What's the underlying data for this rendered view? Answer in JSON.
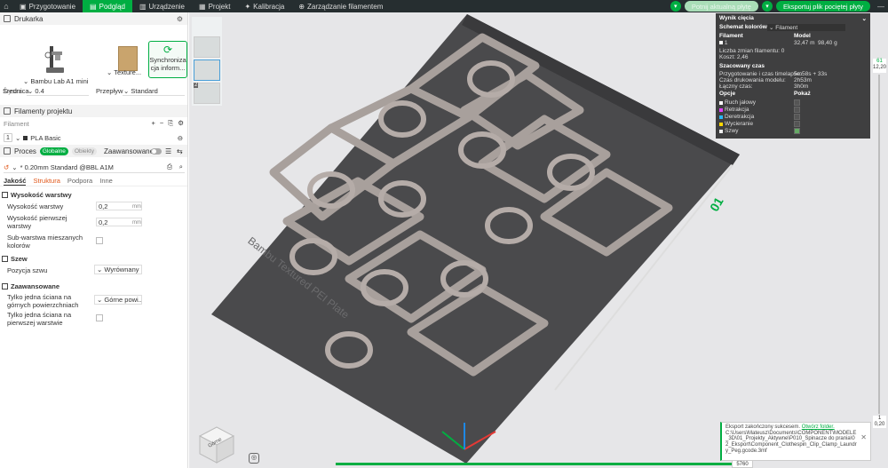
{
  "topbar": {
    "tabs": [
      {
        "label": "Przygotowanie",
        "icon": "prepare-icon"
      },
      {
        "label": "Podgląd",
        "icon": "preview-icon",
        "active": true
      },
      {
        "label": "Urządzenie",
        "icon": "device-icon"
      },
      {
        "label": "Projekt",
        "icon": "project-icon"
      },
      {
        "label": "Kalibracja",
        "icon": "calibration-icon"
      },
      {
        "label": "Zarządzanie filamentem",
        "icon": "filament-manage-icon"
      }
    ],
    "slice_plate": "Potnij aktualną płytę",
    "export_plate": "Eksportuj plik pociętej płyty",
    "accent": "#00ae42"
  },
  "printer": {
    "section": "Drukarka",
    "name": "Bambu Lab A1 mini",
    "plate": "Texture...",
    "sync": "Synchroniza cja inform...",
    "nozzle_label": "Dysza",
    "diameter_label": "Średnica",
    "diameter_value": "0.4",
    "flow_label": "Przepływ",
    "flow_value": "Standard"
  },
  "filaments": {
    "section": "Filamenty projektu",
    "header": "Filament",
    "index": "1",
    "name": "PLA Basic"
  },
  "process": {
    "section": "Proces",
    "badge_global": "Globalne",
    "badge_objects": "Obiekty",
    "advanced": "Zaawansowane",
    "preset": "* 0.20mm Standard @BBL A1M",
    "tabs": [
      "Jakość",
      "Struktura",
      "Podpora",
      "Inne"
    ],
    "groups": {
      "layer_height": "Wysokość warstwy",
      "seam": "Szew",
      "advanced": "Zaawansowane"
    },
    "layer_height_label": "Wysokość warstwy",
    "layer_height_value": "0,2",
    "first_layer_label": "Wysokość pierwszej warstwy",
    "first_layer_value": "0,2",
    "unit": "mm",
    "sublayer_label": "Sub-warstwa mieszanych kolorów",
    "seam_position_label": "Pozycja szwu",
    "seam_position_value": "Wyrównany",
    "single_wall_top_label": "Tylko jedna ściana na górnych powierzchniach",
    "single_wall_top_value": "Górne powi...",
    "single_wall_first_label": "Tylko jedna ściana na pierwszej warstwie"
  },
  "results": {
    "title": "Wynik cięcia",
    "scheme_label": "Schemat kolorów",
    "scheme_value": "Filament",
    "col_filament": "Filament",
    "col_model": "Model",
    "fil_index": "1",
    "fil_length": "32,47 m",
    "fil_weight": "98,40 g",
    "changes_label": "Liczba zmian filamentu:",
    "changes_value": "0",
    "cost_label": "Koszt:",
    "cost_value": "2,46",
    "estimated": "Szacowany czas",
    "prep_label": "Przygotowanie i czas timelapse:",
    "prep_value": "5m58s + 33s",
    "print_label": "Czas drukowania modelu:",
    "print_value": "2h53m",
    "total_label": "Łączny czas:",
    "total_value": "3h0m",
    "options": "Opcje",
    "show": "Pokaż",
    "legend": [
      {
        "label": "Ruch jałowy",
        "color": "#ffffff"
      },
      {
        "label": "Retrakcja",
        "color": "#e040fb"
      },
      {
        "label": "Deretrakcja",
        "color": "#29b6f6"
      },
      {
        "label": "Wycieranie",
        "color": "#ffd600"
      },
      {
        "label": "Szwy",
        "color": "#eeeeee"
      }
    ]
  },
  "notification": {
    "text": "Eksport zakończony sukcesem.",
    "link": "Otwórz folder.",
    "path": "C:\\Users\\Mateusz\\Documents\\COMPONENT\\MODELE_3D\\01_Projekty_Aktywne\\P010_Spinacze do prania\\02_Eksport\\Component_Clothespin_Clip_Clamp_Laundry_Peg.gcode.3mf"
  },
  "viewport": {
    "plate_text": "Bambu Textured PEI Plate",
    "plate_number": "01",
    "layer_top_num": "61",
    "layer_top_h": "12,20",
    "layer_bot_num": "1",
    "layer_bot_h": "0,20",
    "move_value": "5760",
    "cube_label": "Górne"
  }
}
